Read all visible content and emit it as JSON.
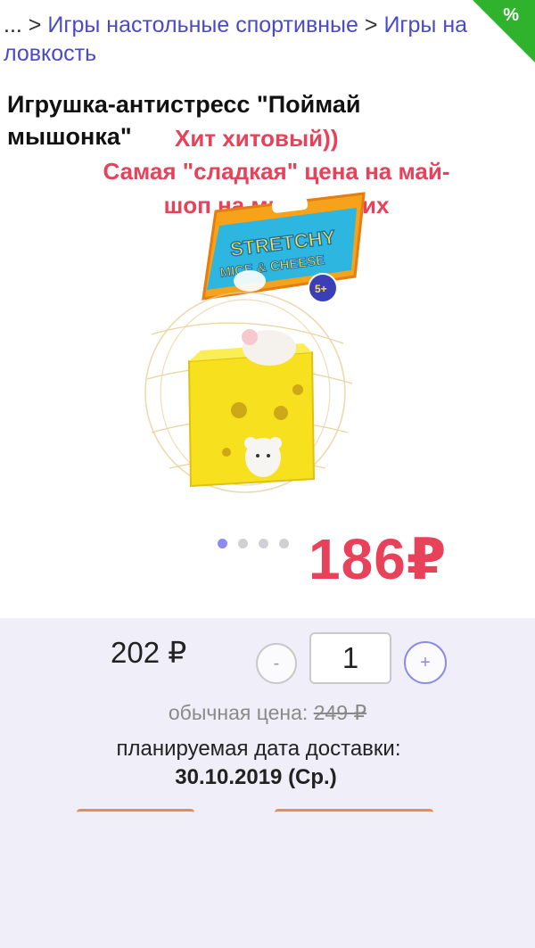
{
  "breadcrumb": {
    "ellipsis": "...",
    "separator": ">",
    "link1": "Игры настольные спортивные",
    "link2": "Игры на ловкость"
  },
  "badge": {
    "text": "%",
    "color": "#2fb32c"
  },
  "product": {
    "title": "Игрушка-антистресс \"Поймай мышонка\"",
    "package_text_1": "STRETCHY",
    "package_text_2": "MICE & CHEESE",
    "age_badge": "5+"
  },
  "promo": {
    "line1": "Хит хитовый))",
    "line2": "Самая \"сладкая\" цена на май-",
    "line3": "шоп на мышек этих",
    "color": "#e8415a"
  },
  "gallery": {
    "count": 4,
    "active_index": 0
  },
  "big_price": "186₽",
  "purchase": {
    "price": "202 ₽",
    "minus_label": "-",
    "quantity": "1",
    "plus_label": "+",
    "regular_label": "обычная цена:",
    "regular_price": "249 ₽",
    "delivery_label": "планируемая дата доставки:",
    "delivery_date": "30.10.2019 (Ср.)"
  },
  "colors": {
    "accent": "#8c8cf0",
    "link": "#4a4ac9",
    "panel_bg": "#efeef9",
    "button_outline": "#ef8a4a"
  }
}
